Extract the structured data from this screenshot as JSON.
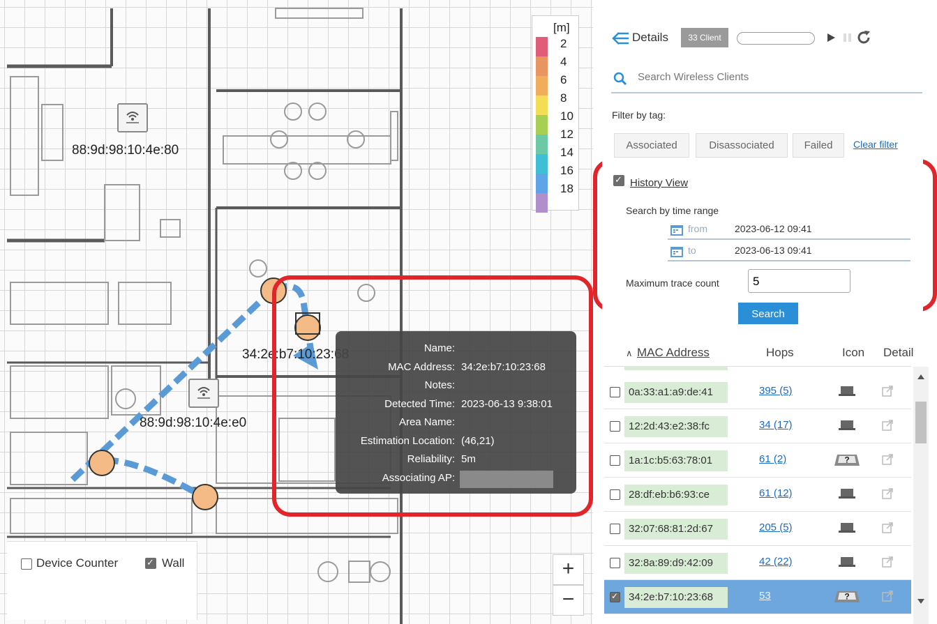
{
  "map": {
    "access_points": [
      {
        "label": "88:9d:98:10:4e:80"
      },
      {
        "label": "88:9d:98:10:4e:e0"
      }
    ],
    "client_label": "34:2e:b7:10:23:68",
    "legend": {
      "unit": "[m]",
      "values": [
        "2",
        "4",
        "6",
        "8",
        "10",
        "12",
        "14",
        "16",
        "18"
      ],
      "colors": [
        "#e15c77",
        "#e9955f",
        "#f0ae5c",
        "#f2dd55",
        "#a7cf54",
        "#6bc9a6",
        "#3ebfd5",
        "#5da4e8",
        "#b08fcb"
      ]
    },
    "tooltip": {
      "rows": [
        {
          "key": "Name:",
          "value": ""
        },
        {
          "key": "MAC Address:",
          "value": "34:2e:b7:10:23:68"
        },
        {
          "key": "Notes:",
          "value": ""
        },
        {
          "key": "Detected Time:",
          "value": "2023-06-13 9:38:01"
        },
        {
          "key": "Area Name:",
          "value": ""
        },
        {
          "key": "Estimation Location:",
          "value": "(46,21)"
        },
        {
          "key": "Reliability:",
          "value": "5m"
        },
        {
          "key": "Associating AP:",
          "value": ""
        }
      ]
    },
    "controls": {
      "device_counter_label": "Device Counter",
      "device_counter_checked": false,
      "wall_label": "Wall",
      "wall_checked": true,
      "zoom_in": "+",
      "zoom_out": "−"
    },
    "accent_color": "#e0262a",
    "trace_color": "#5b9bd5"
  },
  "panel": {
    "title": "Details",
    "client_badge": "33 Client",
    "search_placeholder": "Search Wireless Clients",
    "filter_label": "Filter by tag:",
    "tags": [
      "Associated",
      "Disassociated",
      "Failed"
    ],
    "clear_filter": "Clear filter",
    "history": {
      "label": "History View",
      "checked": true,
      "range_label": "Search by time range",
      "from_label": "from",
      "from_value": "2023-06-12 09:41",
      "to_label": "to",
      "to_value": "2023-06-13 09:41",
      "max_label": "Maximum trace count",
      "max_value": "5",
      "search_button": "Search"
    },
    "table": {
      "headers": {
        "sort": "∧",
        "mac": "MAC Address",
        "hops": "Hops",
        "icon": "Icon",
        "detail": "Detail"
      },
      "rows": [
        {
          "mac": "0a:33:a1:a9:de:41",
          "hops": "395 (5)",
          "icon": "laptop-icon",
          "selected": false
        },
        {
          "mac": "12:2d:43:e2:38:fc",
          "hops": "34 (17)",
          "icon": "laptop-icon",
          "selected": false
        },
        {
          "mac": "1a:1c:b5:63:78:01",
          "hops": "61 (2)",
          "icon": "unknown-device-icon",
          "selected": false
        },
        {
          "mac": "28:df:eb:b6:93:ce",
          "hops": "61 (12)",
          "icon": "laptop-icon",
          "selected": false
        },
        {
          "mac": "32:07:68:81:2d:67",
          "hops": "205 (5)",
          "icon": "laptop-icon",
          "selected": false
        },
        {
          "mac": "32:8a:89:d9:42:09",
          "hops": "42 (22)",
          "icon": "laptop-icon",
          "selected": false
        },
        {
          "mac": "34:2e:b7:10:23:68",
          "hops": "53",
          "icon": "unknown-device-icon",
          "selected": true
        }
      ]
    }
  }
}
